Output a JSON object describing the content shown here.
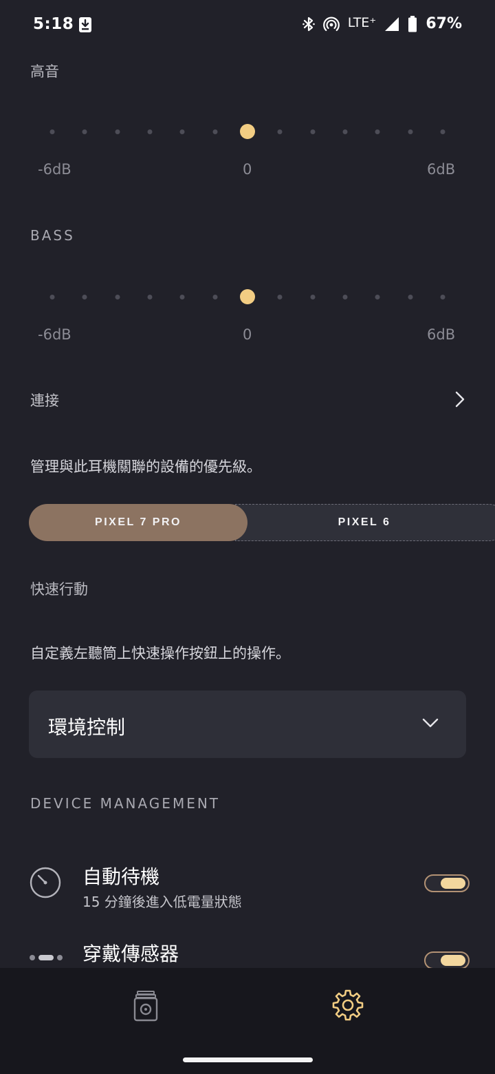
{
  "status": {
    "time": "5:18",
    "network": "LTE⁺",
    "battery": "67%"
  },
  "treble": {
    "label": "高音",
    "min_label": "-6dB",
    "mid_label": "0",
    "max_label": "6dB",
    "value_db": 0,
    "range_db": [
      -6,
      6
    ]
  },
  "bass": {
    "label": "BASS",
    "min_label": "-6dB",
    "mid_label": "0",
    "max_label": "6dB",
    "value_db": 0,
    "range_db": [
      -6,
      6
    ]
  },
  "connection": {
    "label": "連接",
    "description": "管理與此耳機關聯的設備的優先級。",
    "devices": [
      "PIXEL 7 PRO",
      "PIXEL 6"
    ],
    "selected": "PIXEL 7 PRO"
  },
  "quick_action": {
    "label": "快速行動",
    "description": "自定義左聽筒上快速操作按鈕上的操作。",
    "selected": "環境控制"
  },
  "device_management": {
    "label": "DEVICE MANAGEMENT",
    "auto_standby": {
      "title": "自動待機",
      "subtitle": "15 分鐘後進入低電量狀態",
      "enabled": true,
      "icon": "timer-icon"
    },
    "wear_sensor": {
      "title": "穿戴傳感器",
      "enabled": true,
      "icon": "wear-sensor-icon"
    }
  },
  "colors": {
    "background": "#212129",
    "accent": "#f2cd83",
    "selected_segment": "#8c7361",
    "nav_background": "#17171d"
  }
}
